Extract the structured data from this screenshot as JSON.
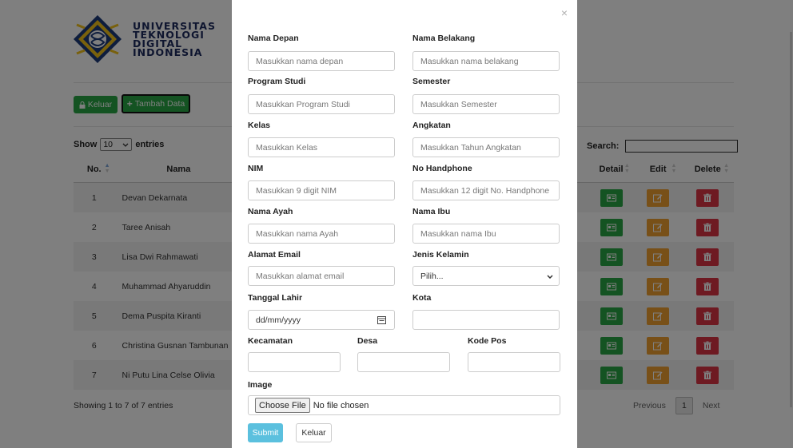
{
  "university": {
    "lines": [
      "UNIVERSITAS",
      "TEKNOLOGI",
      "DIGITAL",
      "INDONESIA"
    ]
  },
  "toolbar": {
    "keluar_label": "Keluar",
    "tambah_label": "Tambah Data"
  },
  "datatable": {
    "show_prefix": "Show",
    "page_length": "10",
    "show_suffix": "entries",
    "search_label": "Search:",
    "search_value": "",
    "columns": {
      "no": "No.",
      "nama": "Nama",
      "detail": "Detail",
      "edit": "Edit",
      "delete": "Delete"
    },
    "rows": [
      {
        "no": "1",
        "nama": "Devan Dekarnata"
      },
      {
        "no": "2",
        "nama": "Taree Anisah"
      },
      {
        "no": "3",
        "nama": "Lisa Dwi Rahmawati"
      },
      {
        "no": "4",
        "nama": "Muhammad Ahyaruddin"
      },
      {
        "no": "5",
        "nama": "Dema Puspita Kiranti"
      },
      {
        "no": "6",
        "nama": "Christina Gusnan Tambunan"
      },
      {
        "no": "7",
        "nama": "Ni Putu Lina Celse Olivia"
      }
    ],
    "info": "Showing 1 to 7 of 7 entries",
    "pagination": {
      "previous": "Previous",
      "page": "1",
      "next": "Next"
    }
  },
  "modal": {
    "close": "×",
    "fields": {
      "nama_depan": {
        "label": "Nama Depan",
        "placeholder": "Masukkan nama depan",
        "value": ""
      },
      "nama_belakang": {
        "label": "Nama Belakang",
        "placeholder": "Masukkan nama belakang",
        "value": ""
      },
      "program_studi": {
        "label": "Program Studi",
        "placeholder": "Masukkan Program Studi",
        "value": ""
      },
      "semester": {
        "label": "Semester",
        "placeholder": "Masukkan Semester",
        "value": ""
      },
      "kelas": {
        "label": "Kelas",
        "placeholder": "Masukkan Kelas",
        "value": ""
      },
      "angkatan": {
        "label": "Angkatan",
        "placeholder": "Masukkan Tahun Angkatan",
        "value": ""
      },
      "nim": {
        "label": "NIM",
        "placeholder": "Masukkan 9 digit NIM",
        "value": ""
      },
      "no_handphone": {
        "label": "No Handphone",
        "placeholder": "Masukkan 12 digit No. Handphone",
        "value": ""
      },
      "nama_ayah": {
        "label": "Nama Ayah",
        "placeholder": "Masukkan nama Ayah",
        "value": ""
      },
      "nama_ibu": {
        "label": "Nama Ibu",
        "placeholder": "Masukkan nama Ibu",
        "value": ""
      },
      "alamat_email": {
        "label": "Alamat Email",
        "placeholder": "Masukkan alamat email",
        "value": ""
      },
      "jenis_kelamin": {
        "label": "Jenis Kelamin",
        "selected": "Pilih..."
      },
      "tanggal_lahir": {
        "label": "Tanggal Lahir",
        "placeholder": "dd/mm/yyyy"
      },
      "kota": {
        "label": "Kota",
        "value": ""
      },
      "kecamatan": {
        "label": "Kecamatan",
        "value": ""
      },
      "desa": {
        "label": "Desa",
        "value": ""
      },
      "kode_pos": {
        "label": "Kode Pos",
        "value": ""
      },
      "image": {
        "label": "Image",
        "button": "Choose File",
        "status": "No file chosen"
      }
    },
    "submit_label": "Submit",
    "keluar_label": "Keluar"
  },
  "colors": {
    "success": "#28a745",
    "warning": "#f0a030",
    "danger": "#dc3545",
    "info": "#5bc0de",
    "brand_text": "#1d2b5e"
  },
  "icons": {
    "keluar": "lock-icon",
    "tambah": "plus-icon",
    "detail": "id-card-icon",
    "edit": "edit-icon",
    "delete": "trash-icon",
    "date": "calendar-icon",
    "select": "chevron-down-icon"
  }
}
